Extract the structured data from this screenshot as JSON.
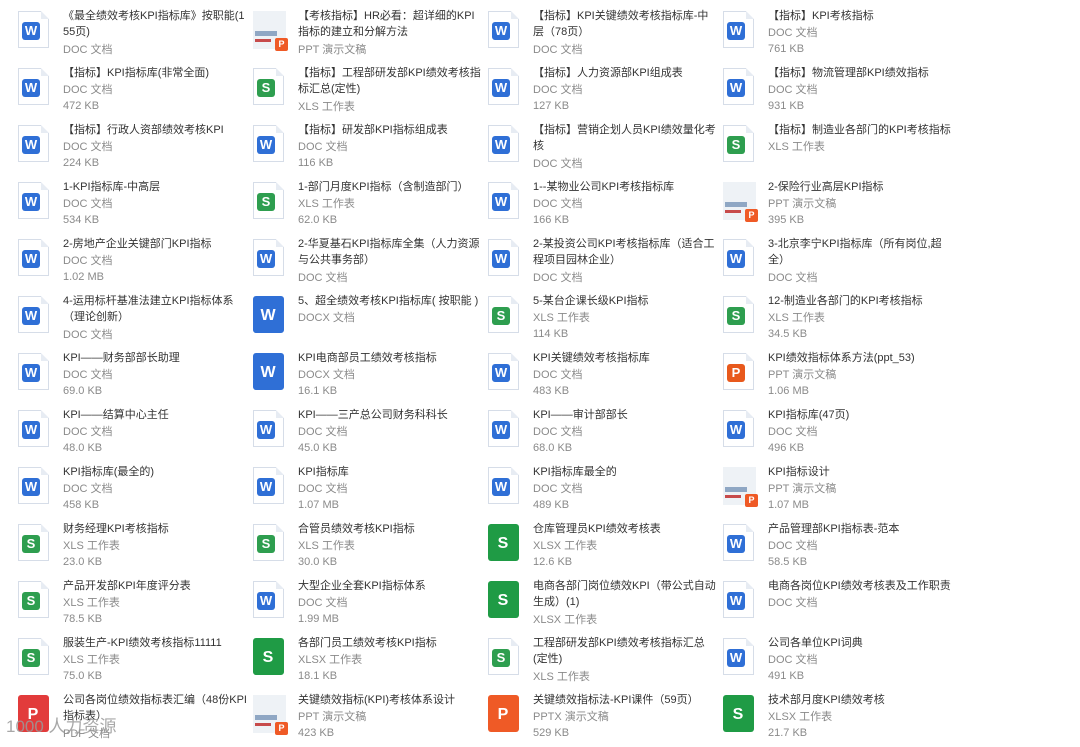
{
  "files": [
    {
      "name": "《最全绩效考核KPI指标库》按职能(155页)",
      "type": "DOC 文档",
      "size": "",
      "icon": "doc"
    },
    {
      "name": "【考核指标】HR必看：超详细的KPI指标的建立和分解方法",
      "type": "PPT 演示文稿",
      "size": "",
      "icon": "ppt-thumb"
    },
    {
      "name": "【指标】KPI关键绩效考核指标库-中层（78页）",
      "type": "DOC 文档",
      "size": "",
      "icon": "doc"
    },
    {
      "name": "【指标】KPI考核指标",
      "type": "DOC 文档",
      "size": "761 KB",
      "icon": "doc"
    },
    {
      "name": "【指标】KPI指标库(非常全面)",
      "type": "DOC 文档",
      "size": "472 KB",
      "icon": "doc"
    },
    {
      "name": "【指标】工程部研发部KPI绩效考核指标汇总(定性)",
      "type": "XLS 工作表",
      "size": "",
      "icon": "xls"
    },
    {
      "name": "【指标】人力资源部KPI组成表",
      "type": "DOC 文档",
      "size": "127 KB",
      "icon": "doc"
    },
    {
      "name": "【指标】物流管理部KPI绩效指标",
      "type": "DOC 文档",
      "size": "931 KB",
      "icon": "doc"
    },
    {
      "name": "【指标】行政人资部绩效考核KPI",
      "type": "DOC 文档",
      "size": "224 KB",
      "icon": "doc"
    },
    {
      "name": "【指标】研发部KPI指标组成表",
      "type": "DOC 文档",
      "size": "116 KB",
      "icon": "doc"
    },
    {
      "name": "【指标】营销企划人员KPI绩效量化考核",
      "type": "DOC 文档",
      "size": "",
      "icon": "doc"
    },
    {
      "name": "【指标】制造业各部门的KPI考核指标",
      "type": "XLS 工作表",
      "size": "",
      "icon": "xls"
    },
    {
      "name": "1-KPI指标库-中高层",
      "type": "DOC 文档",
      "size": "534 KB",
      "icon": "doc"
    },
    {
      "name": "1-部门月度KPI指标（含制造部门）",
      "type": "XLS 工作表",
      "size": "62.0 KB",
      "icon": "xls"
    },
    {
      "name": "1--某物业公司KPI考核指标库",
      "type": "DOC 文档",
      "size": "166 KB",
      "icon": "doc"
    },
    {
      "name": "2-保险行业高层KPI指标",
      "type": "PPT 演示文稿",
      "size": "395 KB",
      "icon": "ppt-thumb"
    },
    {
      "name": "2-房地产企业关键部门KPI指标",
      "type": "DOC 文档",
      "size": "1.02 MB",
      "icon": "doc"
    },
    {
      "name": "2-华夏基石KPI指标库全集（人力资源与公共事务部）",
      "type": "DOC 文档",
      "size": "",
      "icon": "doc"
    },
    {
      "name": "2-某投资公司KPI考核指标库（适合工程项目园林企业）",
      "type": "DOC 文档",
      "size": "",
      "icon": "doc"
    },
    {
      "name": "3-北京李宁KPI指标库（所有岗位,超全）",
      "type": "DOC 文档",
      "size": "",
      "icon": "doc"
    },
    {
      "name": "4-运用标杆基准法建立KPI指标体系（理论创新）",
      "type": "DOC 文档",
      "size": "",
      "icon": "doc"
    },
    {
      "name": "5、超全绩效考核KPI指标库( 按职能 )",
      "type": "DOCX 文档",
      "size": "",
      "icon": "docx"
    },
    {
      "name": "5-某台企课长级KPI指标",
      "type": "XLS 工作表",
      "size": "114 KB",
      "icon": "xls"
    },
    {
      "name": "12-制造业各部门的KPI考核指标",
      "type": "XLS 工作表",
      "size": "34.5 KB",
      "icon": "xls"
    },
    {
      "name": "KPI——财务部部长助理",
      "type": "DOC 文档",
      "size": "69.0 KB",
      "icon": "doc"
    },
    {
      "name": "KPI电商部员工绩效考核指标",
      "type": "DOCX 文档",
      "size": "16.1 KB",
      "icon": "docx"
    },
    {
      "name": "KPI关键绩效考核指标库",
      "type": "DOC 文档",
      "size": "483 KB",
      "icon": "doc"
    },
    {
      "name": "KPI绩效指标体系方法(ppt_53)",
      "type": "PPT 演示文稿",
      "size": "1.06 MB",
      "icon": "ppt"
    },
    {
      "name": "KPI——结算中心主任",
      "type": "DOC 文档",
      "size": "48.0 KB",
      "icon": "doc"
    },
    {
      "name": "KPI——三产总公司财务科科长",
      "type": "DOC 文档",
      "size": "45.0 KB",
      "icon": "doc"
    },
    {
      "name": "KPI——审计部部长",
      "type": "DOC 文档",
      "size": "68.0 KB",
      "icon": "doc"
    },
    {
      "name": "KPI指标库(47页)",
      "type": "DOC 文档",
      "size": "496 KB",
      "icon": "doc"
    },
    {
      "name": "KPI指标库(最全的)",
      "type": "DOC 文档",
      "size": "458 KB",
      "icon": "doc"
    },
    {
      "name": "KPI指标库",
      "type": "DOC 文档",
      "size": "1.07 MB",
      "icon": "doc"
    },
    {
      "name": "KPI指标库最全的",
      "type": "DOC 文档",
      "size": "489 KB",
      "icon": "doc"
    },
    {
      "name": "KPI指标设计",
      "type": "PPT 演示文稿",
      "size": "1.07 MB",
      "icon": "ppt-thumb"
    },
    {
      "name": "财务经理KPI考核指标",
      "type": "XLS 工作表",
      "size": "23.0 KB",
      "icon": "xls"
    },
    {
      "name": "合管员绩效考核KPI指标",
      "type": "XLS 工作表",
      "size": "30.0 KB",
      "icon": "xls"
    },
    {
      "name": "仓库管理员KPI绩效考核表",
      "type": "XLSX 工作表",
      "size": "12.6 KB",
      "icon": "xlsx"
    },
    {
      "name": "产品管理部KPI指标表-范本",
      "type": "DOC 文档",
      "size": "58.5 KB",
      "icon": "doc"
    },
    {
      "name": "产品开发部KPI年度评分表",
      "type": "XLS 工作表",
      "size": "78.5 KB",
      "icon": "xls"
    },
    {
      "name": "大型企业全套KPI指标体系",
      "type": "DOC 文档",
      "size": "1.99 MB",
      "icon": "doc"
    },
    {
      "name": "电商各部门岗位绩效KPI（带公式自动生成）(1)",
      "type": "XLSX 工作表",
      "size": "",
      "icon": "xlsx"
    },
    {
      "name": "电商各岗位KPI绩效考核表及工作职责",
      "type": "DOC 文档",
      "size": "",
      "icon": "doc"
    },
    {
      "name": "服装生产-KPI绩效考核指标11111",
      "type": "XLS 工作表",
      "size": "75.0 KB",
      "icon": "xls"
    },
    {
      "name": "各部门员工绩效考核KPI指标",
      "type": "XLSX 工作表",
      "size": "18.1 KB",
      "icon": "xlsx"
    },
    {
      "name": "工程部研发部KPI绩效考核指标汇总(定性)",
      "type": "XLS 工作表",
      "size": "",
      "icon": "xls"
    },
    {
      "name": "公司各单位KPI词典",
      "type": "DOC 文档",
      "size": "491 KB",
      "icon": "doc"
    },
    {
      "name": "公司各岗位绩效指标表汇编（48份KPI指标表）",
      "type": "PDF 文档",
      "size": "",
      "icon": "pdf"
    },
    {
      "name": "关键绩效指标(KPI)考核体系设计",
      "type": "PPT 演示文稿",
      "size": "423 KB",
      "icon": "ppt-thumb"
    },
    {
      "name": "关键绩效指标法-KPI课件（59页）",
      "type": "PPTX 演示文稿",
      "size": "529 KB",
      "icon": "pptx"
    },
    {
      "name": "技术部月度KPI绩效考核",
      "type": "XLSX 工作表",
      "size": "21.7 KB",
      "icon": "xlsx"
    }
  ],
  "watermark": "1000 人力资源"
}
